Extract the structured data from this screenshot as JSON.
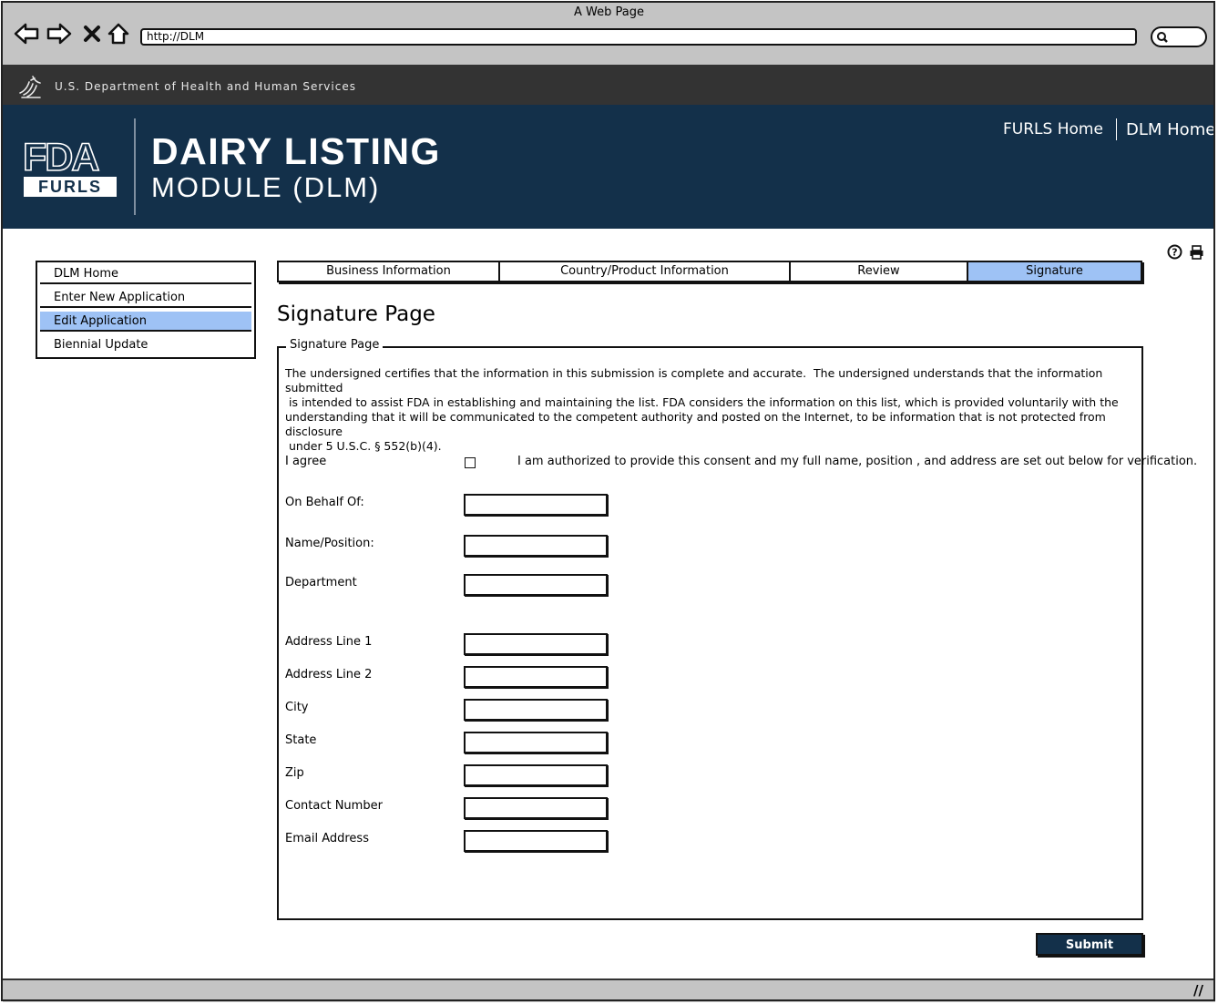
{
  "browser": {
    "window_title": "A Web Page",
    "url": "http://DLM",
    "nav_icons": [
      "back-arrow-icon",
      "forward-arrow-icon",
      "close-x-icon",
      "home-icon"
    ]
  },
  "hhs": {
    "label": "U.S. Department of Health and Human Services"
  },
  "banner": {
    "logo_top": "FDA",
    "logo_bottom": "FURLS",
    "title_line1": "DAIRY LISTING",
    "title_line2": "MODULE (DLM)",
    "links": {
      "furls_home": "FURLS Home",
      "dlm_home": "DLM Home"
    }
  },
  "left_menu": {
    "items": [
      {
        "label": "DLM Home",
        "active": false
      },
      {
        "label": "Enter New Application",
        "active": false
      },
      {
        "label": "Edit Application",
        "active": true
      },
      {
        "label": "Biennial Update",
        "active": false
      }
    ]
  },
  "tabs": [
    {
      "label": "Business Information",
      "active": false
    },
    {
      "label": "Country/Product Information",
      "active": false
    },
    {
      "label": "Review",
      "active": false
    },
    {
      "label": "Signature",
      "active": true
    }
  ],
  "page": {
    "heading": "Signature Page",
    "fieldset_legend": "Signature Page",
    "statement": "The undersigned certifies that the information in this submission is complete and accurate.  The undersigned understands that the information submitted\n is intended to assist FDA in establishing and maintaining the list. FDA considers the information on this list, which is provided voluntarily with the\nunderstanding that it will be communicated to the competent authority and posted on the Internet, to be information that is not protected from disclosure\n under 5 U.S.C. § 552(b)(4).",
    "agree": {
      "label": "I agree",
      "checked": false,
      "text": "I  am authorized to provide this consent and my full name, position , and address are set out below for verification."
    },
    "fields": {
      "on_behalf_of": {
        "label": "On Behalf Of:",
        "value": ""
      },
      "name_position": {
        "label": "Name/Position:",
        "value": ""
      },
      "department": {
        "label": "Department",
        "value": ""
      },
      "address_line_1": {
        "label": "Address Line 1",
        "value": ""
      },
      "address_line_2": {
        "label": "Address Line 2",
        "value": ""
      },
      "city": {
        "label": "City",
        "value": ""
      },
      "state": {
        "label": "State",
        "value": ""
      },
      "zip": {
        "label": "Zip",
        "value": ""
      },
      "contact_number": {
        "label": "Contact Number",
        "value": ""
      },
      "email_address": {
        "label": "Email Address",
        "value": ""
      }
    },
    "submit_label": "Submit"
  },
  "colors": {
    "banner_bg": "#13304a",
    "hhs_bar_bg": "#333333",
    "active_highlight": "#9ec2f5",
    "browser_chrome": "#c4c4c4"
  }
}
